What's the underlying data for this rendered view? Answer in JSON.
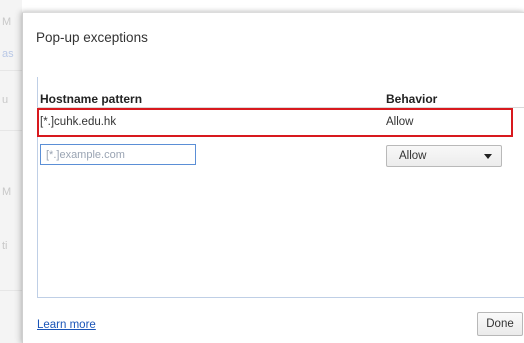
{
  "background_fragments": {
    "frag1": "M",
    "frag2": "as",
    "frag3": "u",
    "frag4": "M",
    "frag5": "ti"
  },
  "dialog": {
    "title": "Pop-up exceptions",
    "columns": {
      "hostname": "Hostname pattern",
      "behavior": "Behavior"
    },
    "rows": [
      {
        "hostname": "[*.]cuhk.edu.hk",
        "behavior": "Allow"
      }
    ],
    "new_entry": {
      "hostname_placeholder": "[*.]example.com",
      "hostname_value": "",
      "behavior_selected": "Allow"
    },
    "footer": {
      "learn_more": "Learn more",
      "done": "Done"
    }
  },
  "colors": {
    "highlight_border": "#d8191e",
    "link": "#1a55b8",
    "input_focus_border": "#5b8fd6"
  }
}
